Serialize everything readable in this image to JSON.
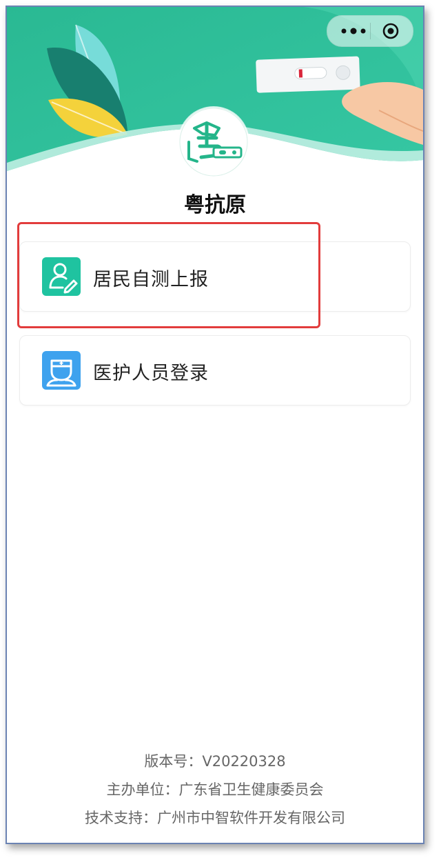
{
  "app": {
    "title": "粤抗原"
  },
  "menu": {
    "items": [
      {
        "label": "居民自测上报",
        "icon": "resident-icon",
        "color": "#1fc3a0"
      },
      {
        "label": "医护人员登录",
        "icon": "medical-staff-icon",
        "color": "#3ea2ee"
      }
    ]
  },
  "footer": {
    "version": "版本号：V20220328",
    "organizer": "主办单位：广东省卫生健康委员会",
    "tech_support": "技术支持：广州市中智软件开发有限公司"
  },
  "colors": {
    "brand": "#20b58f",
    "header_bg": "#2fbf9a",
    "highlight": "#e23c3c"
  },
  "capsule": {
    "more_icon": "more-dots-icon",
    "close_icon": "target-icon"
  }
}
